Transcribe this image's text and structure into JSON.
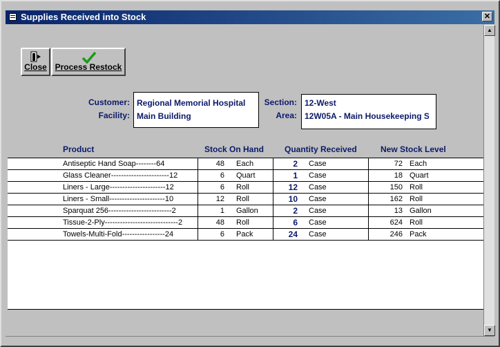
{
  "window": {
    "title": "Supplies Received into Stock",
    "close_glyph": "✕"
  },
  "toolbar": {
    "close_label": "Close",
    "process_label": "Process Restock"
  },
  "header_fields": {
    "customer_label": "Customer:",
    "customer_value": "Regional Memorial Hospital",
    "facility_label": "Facility:",
    "facility_value": "Main Building",
    "section_label": "Section:",
    "section_value": "12-West",
    "area_label": "Area:",
    "area_value": "12W05A - Main Housekeeping S"
  },
  "columns": {
    "product": "Product",
    "stock_on_hand": "Stock On Hand",
    "quantity_received": "Quantity Received",
    "new_stock_level": "New Stock Level"
  },
  "rows": [
    {
      "product": "Antiseptic Hand Soap--------64",
      "soh_qty": "48",
      "soh_unit": "Each",
      "rcv_qty": "2",
      "rcv_unit": "Case",
      "new_qty": "72",
      "new_unit": "Each"
    },
    {
      "product": "Glass Cleaner-----------------------12",
      "soh_qty": "6",
      "soh_unit": "Quart",
      "rcv_qty": "1",
      "rcv_unit": "Case",
      "new_qty": "18",
      "new_unit": "Quart"
    },
    {
      "product": "Liners - Large----------------------12",
      "soh_qty": "6",
      "soh_unit": "Roll",
      "rcv_qty": "12",
      "rcv_unit": "Case",
      "new_qty": "150",
      "new_unit": "Roll"
    },
    {
      "product": "Liners - Small----------------------10",
      "soh_qty": "12",
      "soh_unit": "Roll",
      "rcv_qty": "10",
      "rcv_unit": "Case",
      "new_qty": "162",
      "new_unit": "Roll"
    },
    {
      "product": "Sparquat 256-------------------------2",
      "soh_qty": "1",
      "soh_unit": "Gallon",
      "rcv_qty": "2",
      "rcv_unit": "Case",
      "new_qty": "13",
      "new_unit": "Gallon"
    },
    {
      "product": "Tissue-2-Ply-----------------------------2",
      "soh_qty": "48",
      "soh_unit": "Roll",
      "rcv_qty": "6",
      "rcv_unit": "Case",
      "new_qty": "624",
      "new_unit": "Roll"
    },
    {
      "product": "Towels-Multi-Fold-----------------24",
      "soh_qty": "6",
      "soh_unit": "Pack",
      "rcv_qty": "24",
      "rcv_unit": "Case",
      "new_qty": "246",
      "new_unit": "Pack"
    }
  ],
  "colors": {
    "title_bar": "#0a246a",
    "label_text": "#0b1a6a",
    "checkmark": "#1a9a1a"
  },
  "scrollbar": {
    "up_glyph": "▲",
    "down_glyph": "▼"
  }
}
